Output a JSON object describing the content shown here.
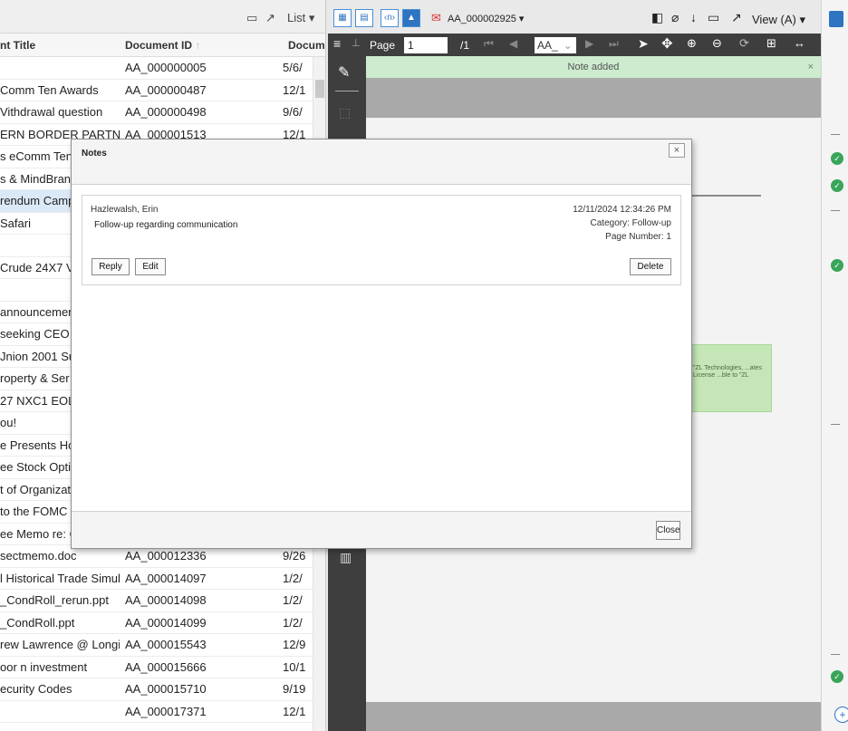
{
  "list": {
    "toolbar": {
      "list_label": "List ▾"
    },
    "columns": {
      "title": "nt Title",
      "doc_id": "Document ID",
      "date": "Docum"
    },
    "rows": [
      {
        "title": "",
        "doc_id": "AA_000000005",
        "date": "5/6/"
      },
      {
        "title": "Comm Ten Awards",
        "doc_id": "AA_000000487",
        "date": "12/1"
      },
      {
        "title": "Vithdrawal question",
        "doc_id": "AA_000000498",
        "date": "9/6/"
      },
      {
        "title": "ERN BORDER PARTNER",
        "doc_id": "AA_000001513",
        "date": "12/1"
      },
      {
        "title": "s eComm Ten",
        "doc_id": "",
        "date": ""
      },
      {
        "title": "s & MindBran",
        "doc_id": "",
        "date": ""
      },
      {
        "title": "rendum Camp",
        "doc_id": "",
        "date": "",
        "selected": true
      },
      {
        "title": "Safari",
        "doc_id": "",
        "date": ""
      },
      {
        "title": "",
        "doc_id": "",
        "date": ""
      },
      {
        "title": "Crude 24X7 V",
        "doc_id": "",
        "date": ""
      },
      {
        "title": "",
        "doc_id": "",
        "date": ""
      },
      {
        "title": "announcemen",
        "doc_id": "",
        "date": ""
      },
      {
        "title": "seeking CEO",
        "doc_id": "",
        "date": ""
      },
      {
        "title": "Jnion 2001 Su",
        "doc_id": "",
        "date": ""
      },
      {
        "title": "roperty & Ser",
        "doc_id": "",
        "date": ""
      },
      {
        "title": "27 NXC1 EOL T",
        "doc_id": "",
        "date": ""
      },
      {
        "title": "ou!",
        "doc_id": "",
        "date": ""
      },
      {
        "title": "e Presents Hoc",
        "doc_id": "",
        "date": ""
      },
      {
        "title": "ee Stock Optic",
        "doc_id": "",
        "date": ""
      },
      {
        "title": "t of Organizat",
        "doc_id": "",
        "date": ""
      },
      {
        "title": "to the FOMC c",
        "doc_id": "",
        "date": ""
      },
      {
        "title": "ee Memo re: C",
        "doc_id": "",
        "date": ""
      },
      {
        "title": "sectmemo.doc",
        "doc_id": "AA_000012336",
        "date": "9/26"
      },
      {
        "title": "l Historical Trade Simul",
        "doc_id": "AA_000014097",
        "date": "1/2/"
      },
      {
        "title": "_CondRoll_rerun.ppt",
        "doc_id": "AA_000014098",
        "date": "1/2/"
      },
      {
        "title": "_CondRoll.ppt",
        "doc_id": "AA_000014099",
        "date": "1/2/"
      },
      {
        "title": "rew Lawrence @ Longit",
        "doc_id": "AA_000015543",
        "date": "12/9"
      },
      {
        "title": "oor n investment",
        "doc_id": "AA_000015666",
        "date": "10/1"
      },
      {
        "title": "ecurity Codes",
        "doc_id": "AA_000015710",
        "date": "9/19"
      },
      {
        "title": "",
        "doc_id": "AA_000017371",
        "date": "12/1"
      }
    ]
  },
  "viewer": {
    "doc_name": "AA_000002925 ▾",
    "view_label": "View (A) ▾",
    "page_label": "Page",
    "page_value": "1",
    "page_total": "/1",
    "zoom_value": "AA_",
    "banner": "Note added",
    "green_note_text": "\"ZL Technologies, ...ates License ...ble to \"ZL"
  },
  "dialog": {
    "title": "Notes",
    "author": "Hazlewalsh, Erin",
    "note_text": "Follow-up regarding communication",
    "date": "12/11/2024 12:34:26 PM",
    "category": "Category: Follow-up",
    "page_number": "Page Number: 1",
    "reply_label": "Reply",
    "edit_label": "Edit",
    "delete_label": "Delete",
    "close_label": "Close"
  },
  "colors": {
    "accent": "#2e74c0",
    "success": "#3aa55a",
    "banner": "#cdeccf",
    "dark_toolbar": "#3e3e3e"
  }
}
